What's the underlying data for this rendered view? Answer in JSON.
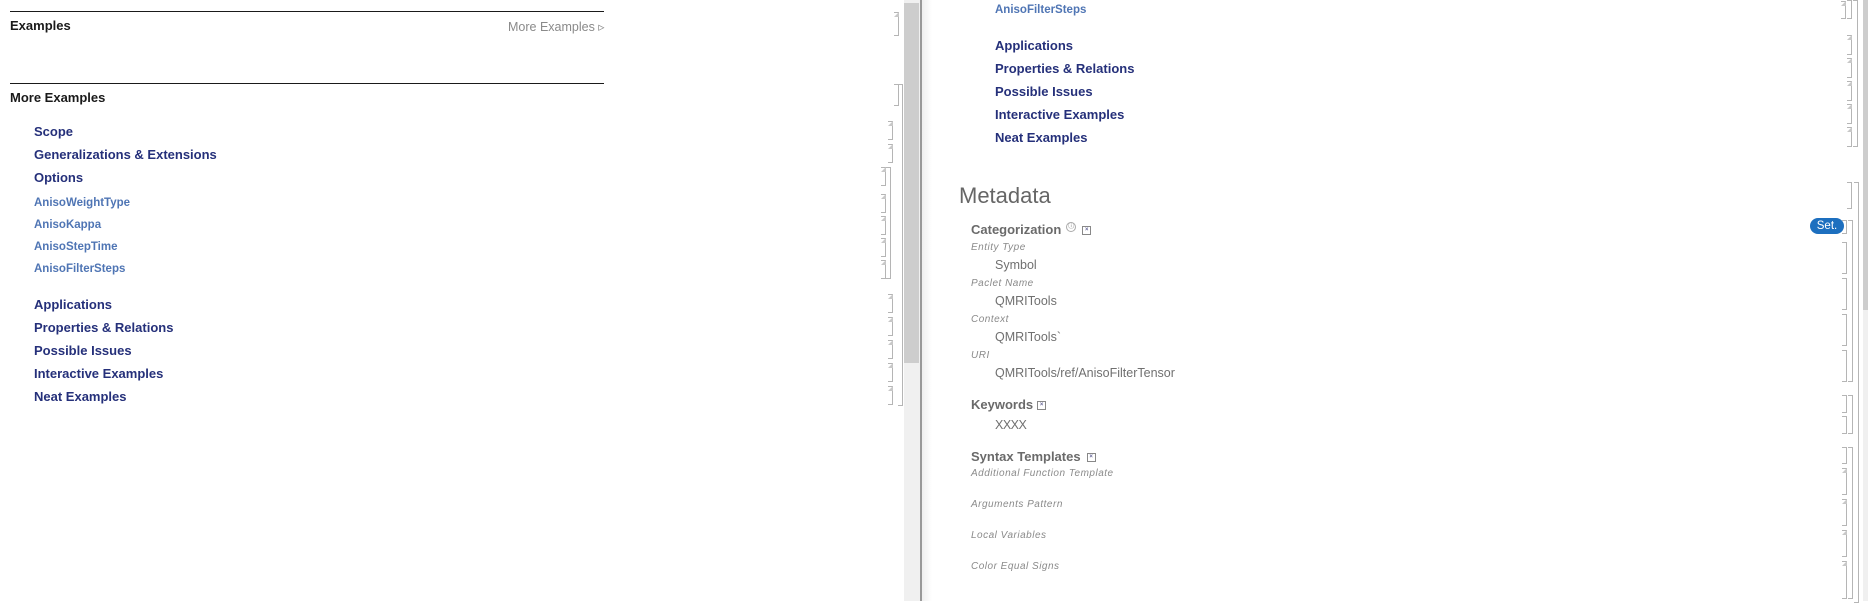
{
  "left": {
    "examples_title": "Examples",
    "more_examples_link": "More Examples ▹",
    "more_examples_title": "More Examples",
    "sections_primary": [
      {
        "label": "Scope"
      },
      {
        "label": "Generalizations & Extensions"
      },
      {
        "label": "Options"
      }
    ],
    "options": [
      {
        "label": "AnisoWeightType"
      },
      {
        "label": "AnisoKappa"
      },
      {
        "label": "AnisoStepTime"
      },
      {
        "label": "AnisoFilterSteps"
      }
    ],
    "sections_secondary": [
      {
        "label": "Applications"
      },
      {
        "label": "Properties & Relations"
      },
      {
        "label": "Possible Issues"
      },
      {
        "label": "Interactive Examples"
      },
      {
        "label": "Neat Examples"
      }
    ]
  },
  "right": {
    "option_tail": "AnisoFilterSteps",
    "sections_secondary": [
      {
        "label": "Applications"
      },
      {
        "label": "Properties & Relations"
      },
      {
        "label": "Possible Issues"
      },
      {
        "label": "Interactive Examples"
      },
      {
        "label": "Neat Examples"
      }
    ],
    "metadata": {
      "title": "Metadata",
      "categorization": {
        "title": "Categorization",
        "set_button": "Set.",
        "fields": [
          {
            "label": "Entity Type",
            "value": "Symbol"
          },
          {
            "label": "Paclet Name",
            "value": "QMRITools"
          },
          {
            "label": "Context",
            "value": "QMRITools`"
          },
          {
            "label": "URI",
            "value": "QMRITools/ref/AnisoFilterTensor"
          }
        ]
      },
      "keywords": {
        "title": "Keywords",
        "value": "XXXX"
      },
      "syntax_templates": {
        "title": "Syntax Templates",
        "fields": [
          {
            "label": "Additional Function Template"
          },
          {
            "label": "Arguments Pattern"
          },
          {
            "label": "Local Variables"
          },
          {
            "label": "Color Equal Signs"
          }
        ]
      }
    }
  },
  "icons": {
    "info": "ⓘ",
    "box": "⊠"
  }
}
